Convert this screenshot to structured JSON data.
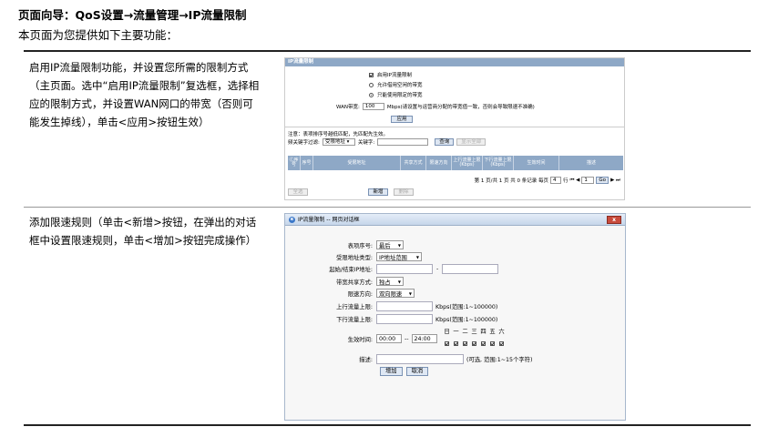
{
  "header": {
    "title": "页面向导：QoS设置→流量管理→IP流量限制",
    "intro": "本页面为您提供如下主要功能："
  },
  "section1": {
    "desc_lines": [
      "启用IP流量限制功能，并设置您所需的限制方式",
      "（主页面。选中“启用IP流量限制”复选框，选择相",
      "应的限制方式，并设置WAN网口的带宽（否则可",
      "能发生掉线），单击<应用>按钮生效）"
    ],
    "shot": {
      "panel_title": "IP流量限制",
      "opt_enable": "启用IP流量限制",
      "opt_shared": "允许借用空闲的带宽",
      "opt_limit": "只能使用限定的带宽",
      "wan_label": "WAN带宽:",
      "wan_value": "100",
      "wan_hint": "Mbps(请设置与运营商分配的带宽值一致，否则会导致限速不准确)",
      "apply": "应用",
      "note": "注意：表项排序号越低匹配，先匹配先生效。",
      "filter_label": "频关键字过滤:",
      "filter_select": "受限地址",
      "keyword_label": "关键字:",
      "search_btn": "查询",
      "showall_btn": "显示全部",
      "columns": [
        "Ⓒ序号",
        "序号",
        "受限地址",
        "共享方式",
        "限速方向",
        "上行流量上限(Kbps)",
        "下行流量上限(Kbps)",
        "生效时间",
        "描述"
      ],
      "pager": "第 1 页/共 1 页 共 0 条记录 每页",
      "per_page": "4",
      "per_page_unit": "行",
      "page_nav": "⏮ ◀",
      "page_num": "1",
      "go": "Go",
      "page_nav_end": "▶ ⏭",
      "selectall_btn": "全选",
      "add_btn": "新增",
      "delete_btn": "删除"
    }
  },
  "section2": {
    "desc_lines": [
      "添加限速规则（单击<新增>按钮，在弹出的对话",
      "框中设置限速规则，单击<增加>按钮完成操作）"
    ],
    "dialog": {
      "window_title": "IP流量限制 -- 网页对话框",
      "close": "x",
      "order_label": "表项序号:",
      "order_value": "最后",
      "addr_type_label": "受限地址类型:",
      "addr_type_value": "IP地址范围",
      "ip_range_label": "起始/结束IP地址:",
      "ip_dash": "-",
      "share_label": "带宽共享方式:",
      "share_value": "独占",
      "dir_label": "限速方向:",
      "dir_value": "双向限速",
      "up_label": "上行流量上限:",
      "up_hint": "Kbps(范围:1~100000)",
      "down_label": "下行流量上限:",
      "down_hint": "Kbps(范围:1~100000)",
      "time_label": "生效时间:",
      "time_start": "00:00",
      "time_sep": "--",
      "time_end": "24:00",
      "days": [
        "日",
        "一",
        "二",
        "三",
        "四",
        "五",
        "六"
      ],
      "desc_label": "描述:",
      "desc_hint": "(可选, 范围:1~15个字符)",
      "add_btn": "增加",
      "cancel_btn": "取消"
    }
  }
}
